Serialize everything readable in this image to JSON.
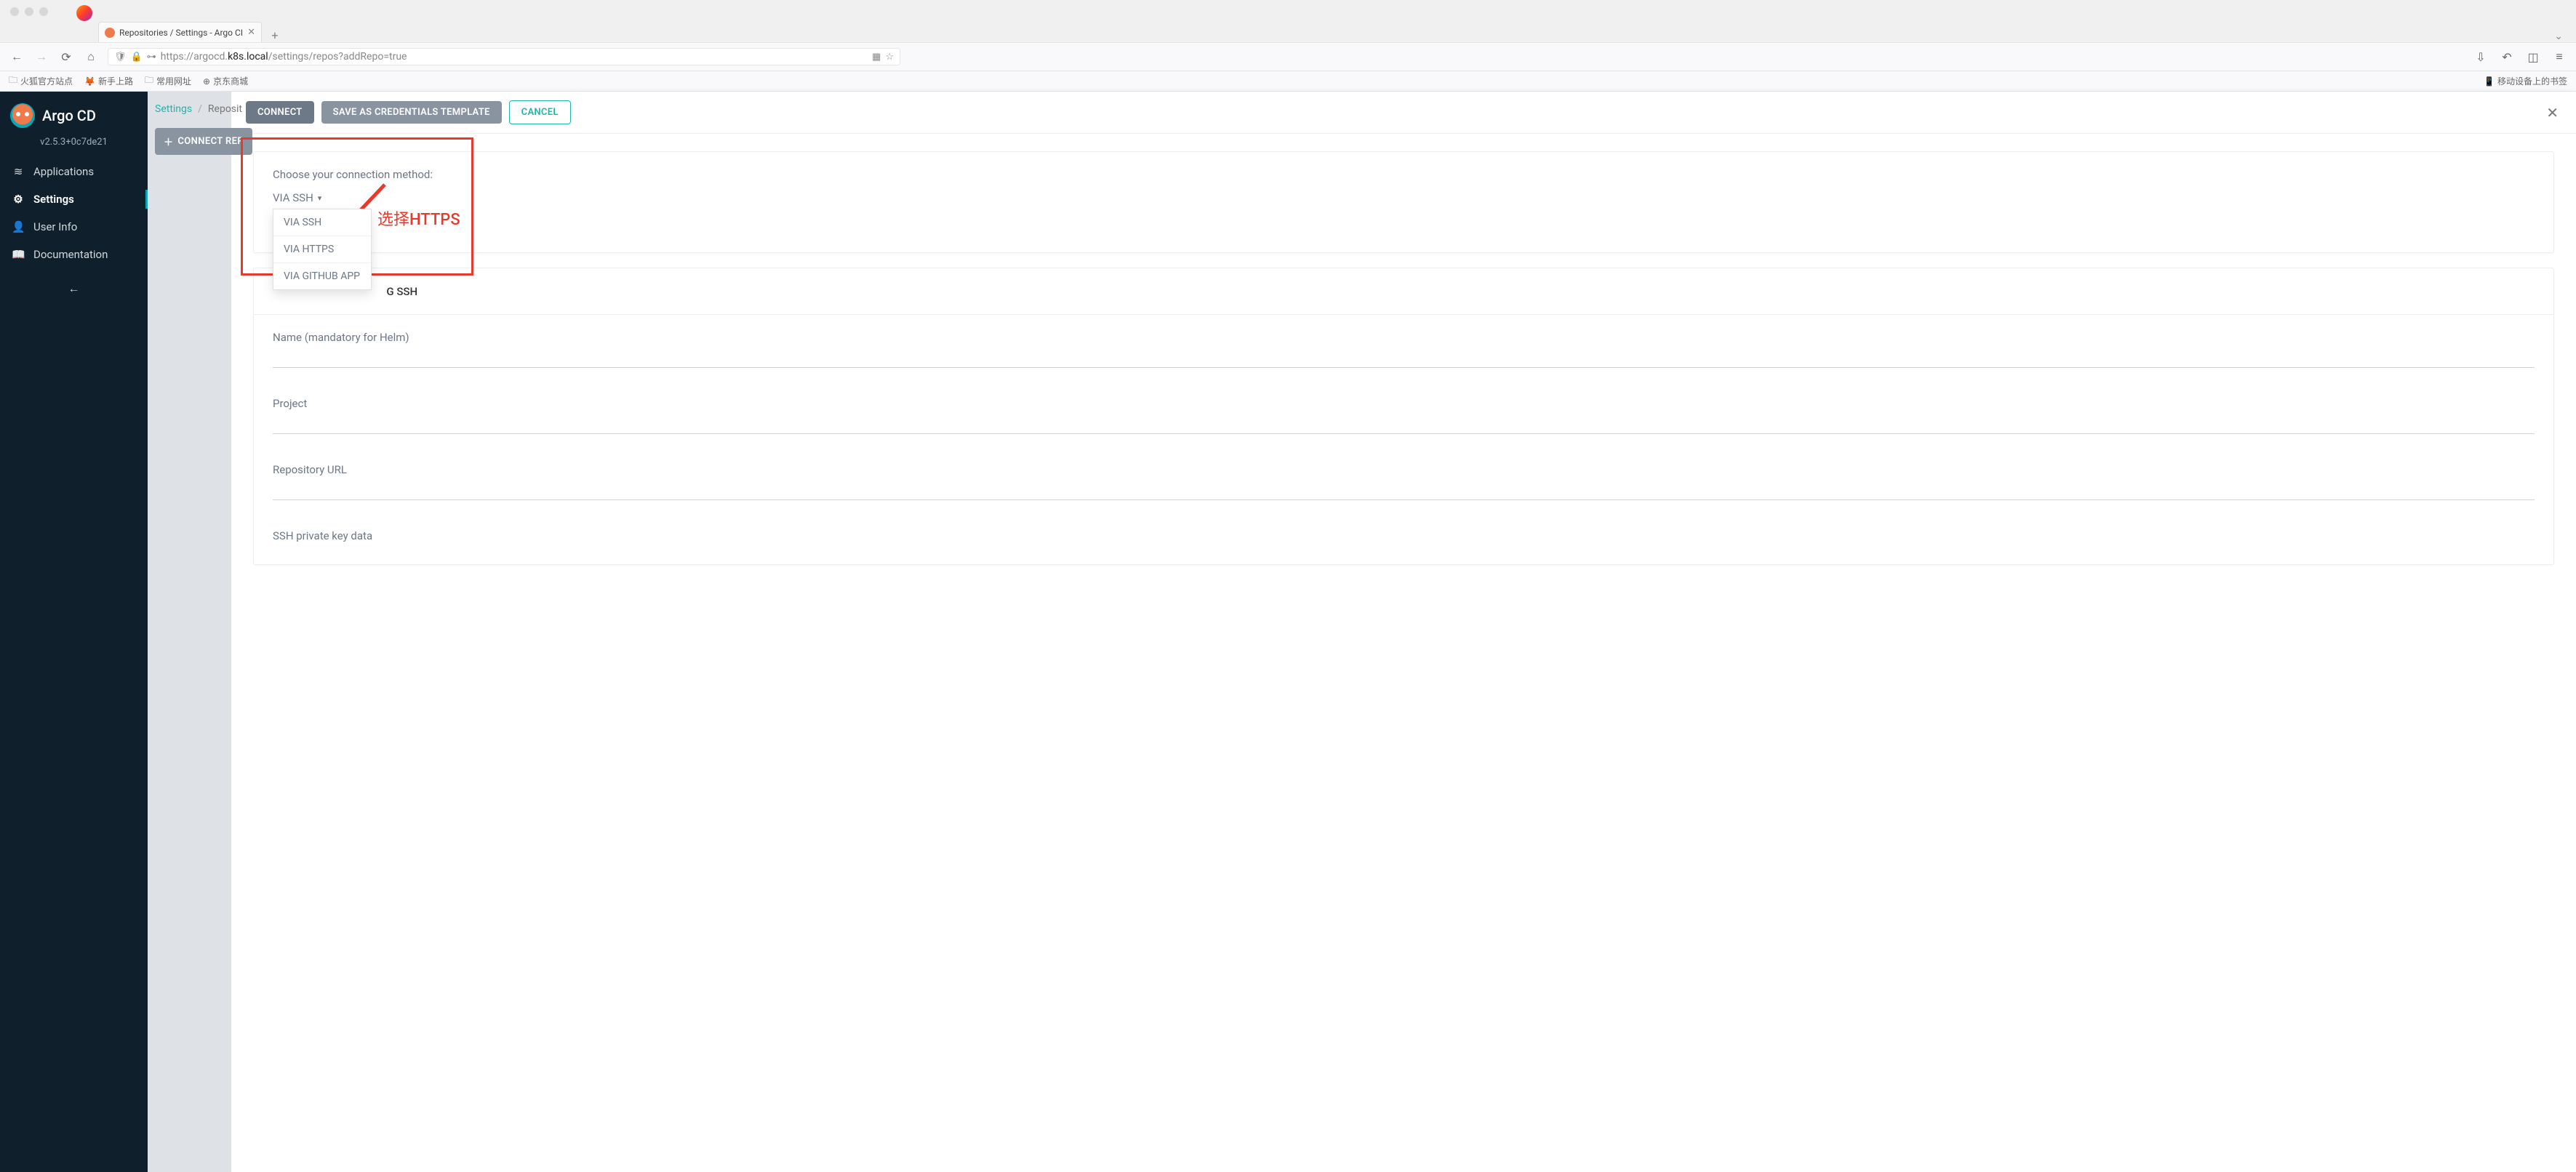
{
  "browser": {
    "tab_title": "Repositories / Settings - Argo CI",
    "url_prefix": "https://argocd.",
    "url_host": "k8s.local",
    "url_path": "/settings/repos?addRepo=true",
    "bookmarks": {
      "b1": "火狐官方站点",
      "b2": "新手上路",
      "b3": "常用网址",
      "b4": "京东商城",
      "mobile": "移动设备上的书签"
    }
  },
  "sidebar": {
    "title": "Argo CD",
    "version": "v2.5.3+0c7de21",
    "items": {
      "apps": "Applications",
      "settings": "Settings",
      "user": "User Info",
      "docs": "Documentation"
    }
  },
  "page": {
    "breadcrumb_root": "Settings",
    "breadcrumb_current": "Reposit",
    "connect_repo_btn": "CONNECT REP"
  },
  "panel": {
    "connect_btn": "CONNECT",
    "save_tpl_btn": "SAVE AS CREDENTIALS TEMPLATE",
    "cancel_btn": "CANCEL",
    "choose_label": "Choose your connection method:",
    "dd_selected": "VIA SSH",
    "dd_options": {
      "ssh": "VIA SSH",
      "https": "VIA HTTPS",
      "gh": "VIA GITHUB APP"
    },
    "section_ssh_tail": "G SSH",
    "annotation": "选择HTTPS",
    "fields": {
      "name": "Name (mandatory for Helm)",
      "project": "Project",
      "repo": "Repository URL",
      "ssh_key": "SSH private key data"
    }
  }
}
